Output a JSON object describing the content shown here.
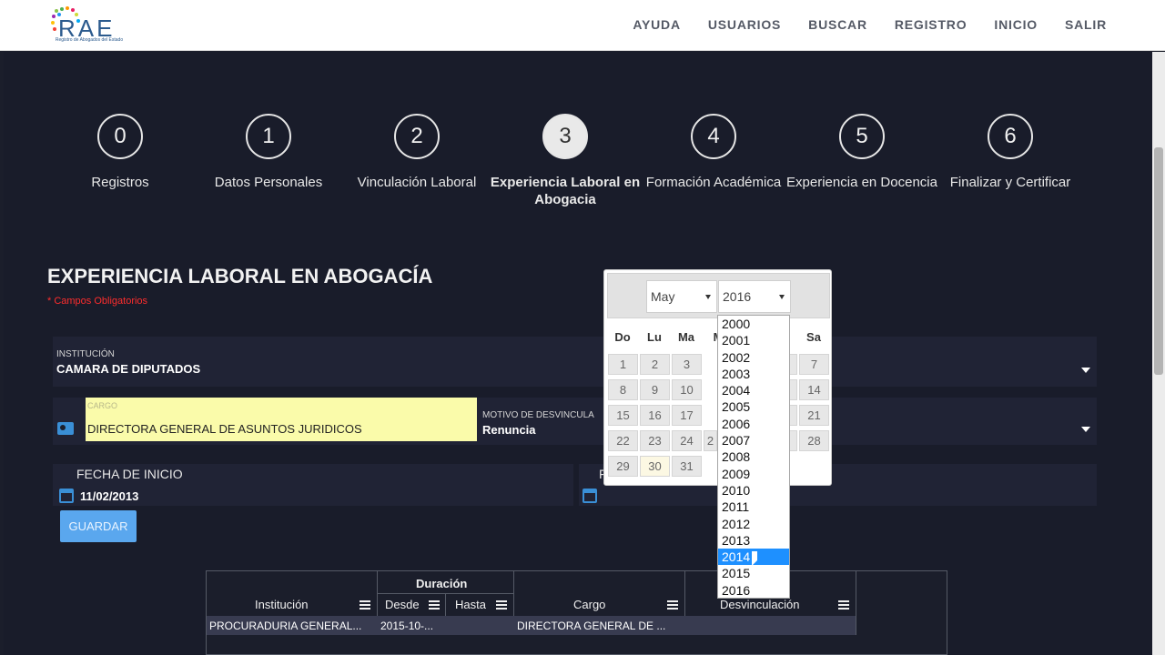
{
  "brand": {
    "logo_text": "RAE",
    "logo_sub": "Registro de Abogados del Estado"
  },
  "nav": {
    "items": [
      "AYUDA",
      "USUARIOS",
      "BUSCAR",
      "REGISTRO",
      "INICIO",
      "SALIR"
    ]
  },
  "steps": [
    {
      "num": "0",
      "label": "Registros"
    },
    {
      "num": "1",
      "label": "Datos Personales"
    },
    {
      "num": "2",
      "label": "Vinculación Laboral"
    },
    {
      "num": "3",
      "label": "Experiencia Laboral en Abogacia",
      "active": true
    },
    {
      "num": "4",
      "label": "Formación Académica"
    },
    {
      "num": "5",
      "label": "Experiencia en Docencia"
    },
    {
      "num": "6",
      "label": "Finalizar y Certificar"
    }
  ],
  "form": {
    "title": "EXPERIENCIA LABORAL EN ABOGACÍA",
    "required_note": "* Campos Obligatorios",
    "institucion_label": "INSTITUCIÓN",
    "institucion_value": "CAMARA DE DIPUTADOS",
    "cargo_label": "CARGO",
    "cargo_value": "DIRECTORA GENERAL DE ASUNTOS JURIDICOS",
    "motivo_label": "MOTIVO DE DESVINCULA",
    "motivo_value": "Renuncia",
    "fecha_inicio_label": "FECHA DE INICIO",
    "fecha_inicio_value": "11/02/2013",
    "fecha_fin_label": "F",
    "save_label": "GUARDAR"
  },
  "grid": {
    "group_header": "Duración",
    "columns": [
      "Institución",
      "Desde",
      "Hasta",
      "Cargo",
      "Desvinculación"
    ],
    "rows": [
      {
        "institucion": "PROCURADURIA GENERAL...",
        "desde": "2015-10-...",
        "hasta": "",
        "cargo": "DIRECTORA GENERAL DE ...",
        "desvinculacion": ""
      }
    ]
  },
  "datepicker": {
    "month": "May",
    "year": "2016",
    "weekdays": [
      "Do",
      "Lu",
      "Ma",
      "M",
      "",
      "",
      "Sa"
    ],
    "weeks": [
      [
        "1",
        "2",
        "3",
        "",
        "",
        "6",
        "7"
      ],
      [
        "8",
        "9",
        "10",
        "",
        "",
        "3",
        "14"
      ],
      [
        "15",
        "16",
        "17",
        "",
        "",
        "0",
        "21"
      ],
      [
        "22",
        "23",
        "24",
        "2",
        "",
        "7",
        "28"
      ],
      [
        "29",
        "30",
        "31",
        "",
        "",
        "",
        ""
      ]
    ],
    "today": "30",
    "year_options": [
      "2000",
      "2001",
      "2002",
      "2003",
      "2004",
      "2005",
      "2006",
      "2007",
      "2008",
      "2009",
      "2010",
      "2011",
      "2012",
      "2013",
      "2014",
      "2015",
      "2016"
    ],
    "highlighted_year": "2014"
  },
  "colors": {
    "accent": "#1e90ff",
    "background": "#191c2a",
    "cargo_highlight": "#fafbaa",
    "required": "#ff2d2d"
  }
}
